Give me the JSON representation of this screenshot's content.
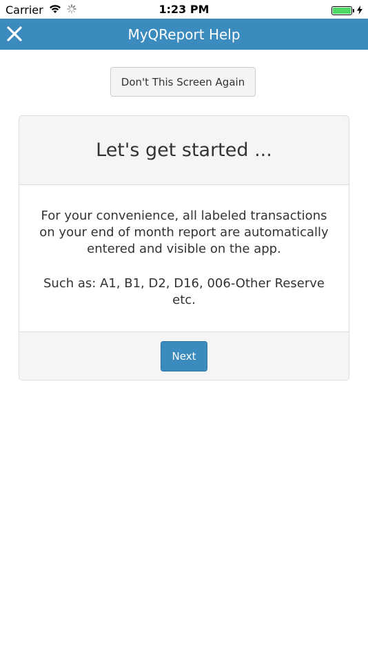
{
  "status_bar": {
    "carrier": "Carrier",
    "time": "1:23 PM",
    "battery_level": 1.0
  },
  "nav": {
    "title": "MyQReport Help",
    "close_icon": "close-icon"
  },
  "dont_show_label": "Don't This Screen Again",
  "card": {
    "title": "Let's get started ...",
    "paragraph1": "For your convenience, all labeled transactions on your end of month report are automatically entered and visible on the app.",
    "paragraph2": "Such as: A1, B1, D2, D16, 006-Other Reserve etc.",
    "next_label": "Next"
  },
  "colors": {
    "accent": "#3b8bbf",
    "battery": "#4cd964"
  }
}
